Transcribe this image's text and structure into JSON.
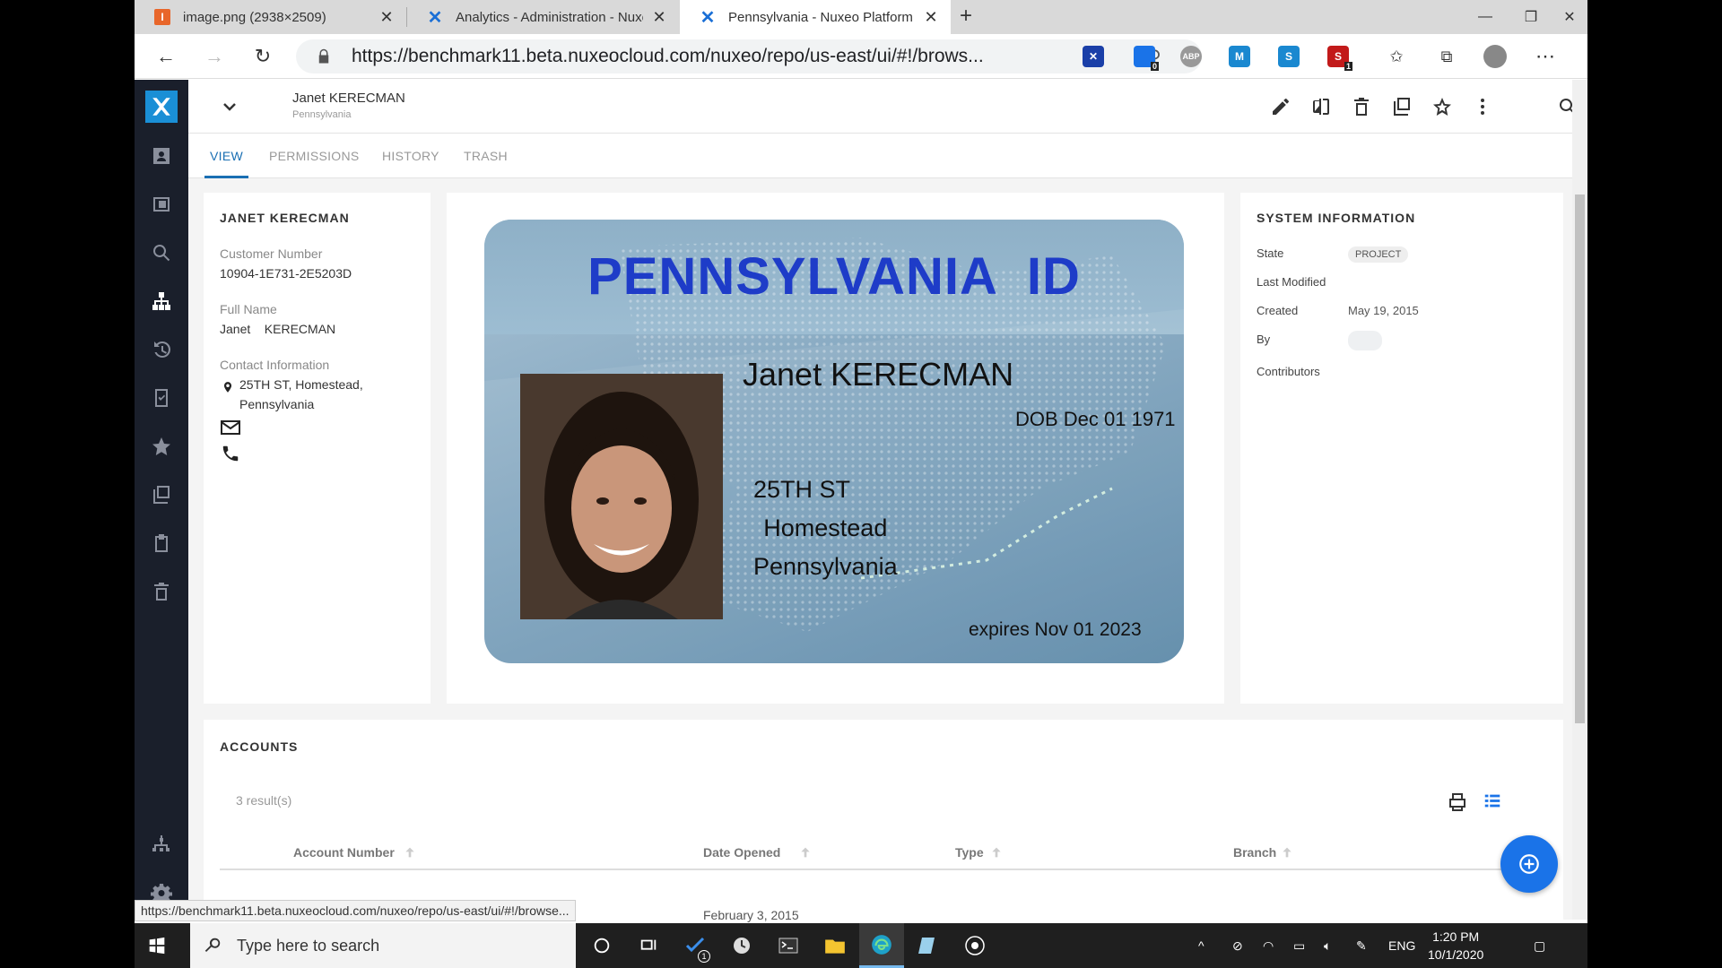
{
  "browser": {
    "tabs": [
      {
        "title": "image.png (2938×2509)",
        "icon": "image-favicon",
        "active": false
      },
      {
        "title": "Analytics - Administration - Nuxeo",
        "icon": "nuxeo-favicon",
        "active": false
      },
      {
        "title": "Pennsylvania - Nuxeo Platform",
        "icon": "nuxeo-favicon",
        "active": true
      }
    ],
    "url": "https://benchmark11.beta.nuxeocloud.com/nuxeo/repo/us-east/ui/#!/brows...",
    "status_url": "https://benchmark11.beta.nuxeocloud.com/nuxeo/repo/us-east/ui/#!/browse...",
    "extension_badges": {
      "ext2": "0",
      "ext7": "1"
    },
    "extension_labels": {
      "abp": "ABP"
    }
  },
  "header": {
    "title": "Janet KERECMAN",
    "subtitle": "Pennsylvania"
  },
  "tabs": [
    "VIEW",
    "PERMISSIONS",
    "HISTORY",
    "TRASH"
  ],
  "customer": {
    "heading": "JANET KERECMAN",
    "customer_number_label": "Customer Number",
    "customer_number": "10904-1E731-2E5203D",
    "full_name_label": "Full Name",
    "full_name": "Janet    KERECMAN",
    "contact_label": "Contact Information",
    "address_line1": "25TH ST, Homestead,",
    "address_line2": "Pennsylvania"
  },
  "id_card": {
    "title": "PENNSYLVANIA  ID",
    "name": "Janet KERECMAN",
    "dob": "DOB Dec 01 1971",
    "address1": "25TH ST",
    "address2": "Homestead",
    "address3": "Pennsylvania",
    "expires": "expires Nov 01 2023"
  },
  "system_info": {
    "heading": "SYSTEM INFORMATION",
    "state_label": "State",
    "state": "PROJECT",
    "last_modified_label": "Last Modified",
    "created_label": "Created",
    "created": "May 19, 2015",
    "by_label": "By",
    "contributors_label": "Contributors"
  },
  "accounts": {
    "heading": "ACCOUNTS",
    "results": "3 result(s)",
    "columns": [
      "Account Number",
      "Date Opened",
      "Type",
      "Branch"
    ],
    "partial_row_date": "February 3, 2015"
  },
  "taskbar": {
    "search_placeholder": "Type here to search",
    "language": "ENG",
    "time": "1:20 PM",
    "date": "10/1/2020",
    "todo_badge": "1"
  },
  "colors": {
    "accent": "#1a6fb3",
    "sidebar": "#1a1f2b",
    "id_title": "#1e3cc8",
    "fab": "#1a73e8"
  }
}
